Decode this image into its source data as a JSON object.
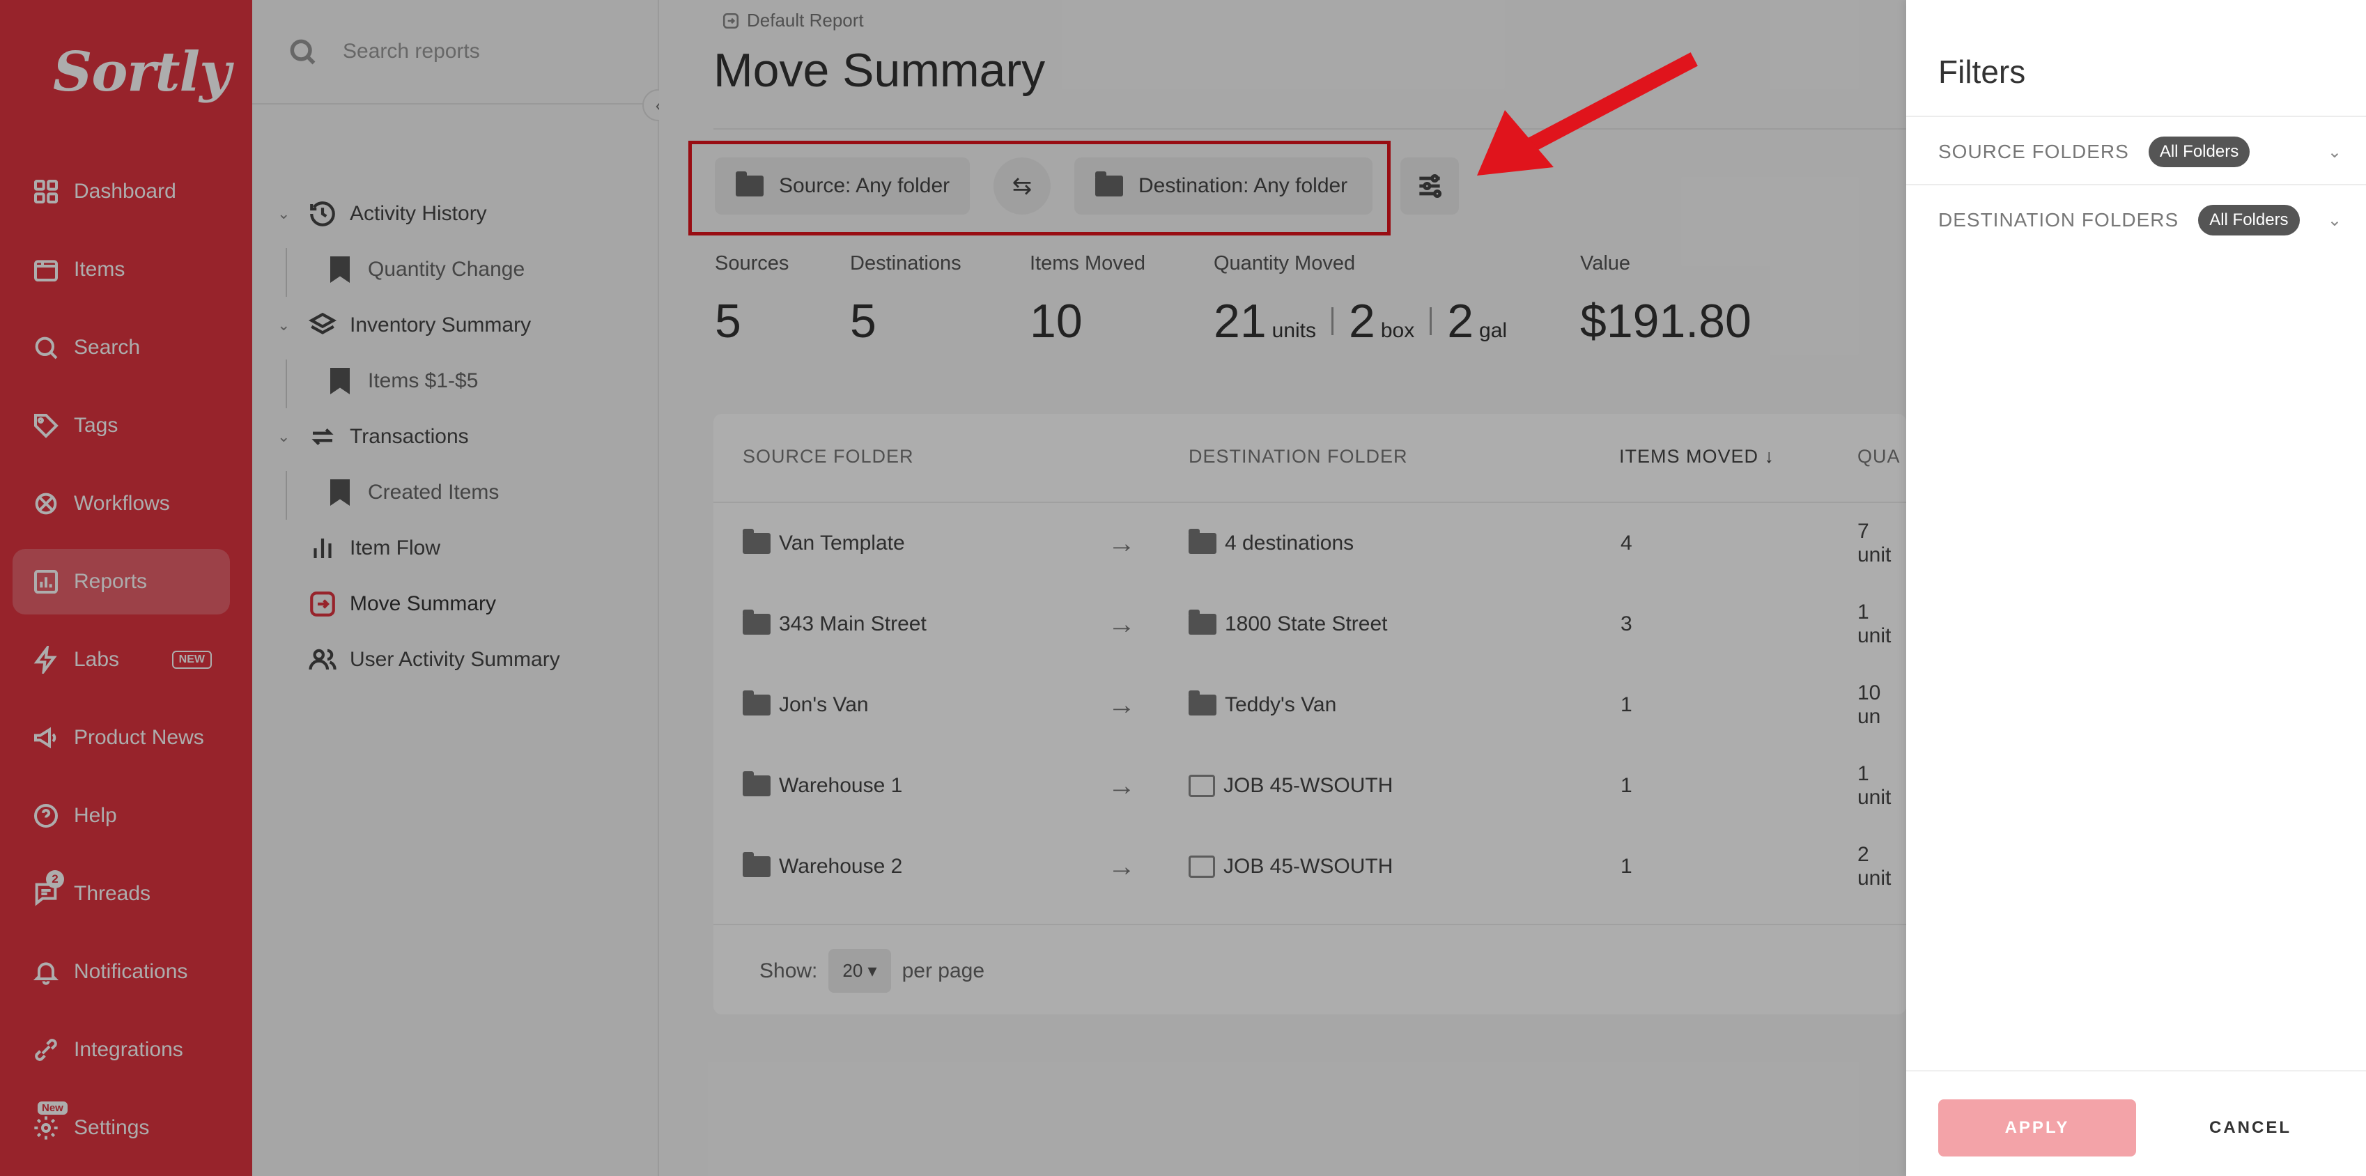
{
  "brand": {
    "logo": "Sortly",
    "color": "#df3440"
  },
  "sidebar": {
    "items": [
      {
        "label": "Dashboard",
        "icon": "dashboard-icon"
      },
      {
        "label": "Items",
        "icon": "items-icon"
      },
      {
        "label": "Search",
        "icon": "search-icon"
      },
      {
        "label": "Tags",
        "icon": "tag-icon"
      },
      {
        "label": "Workflows",
        "icon": "workflows-icon"
      },
      {
        "label": "Reports",
        "icon": "reports-icon",
        "active": true
      },
      {
        "label": "Labs",
        "icon": "lightning-icon",
        "badge": "NEW"
      },
      {
        "label": "Product News",
        "icon": "megaphone-icon"
      },
      {
        "label": "Help",
        "icon": "help-icon"
      },
      {
        "label": "Threads",
        "icon": "threads-icon",
        "count": "2"
      },
      {
        "label": "Notifications",
        "icon": "bell-icon"
      },
      {
        "label": "Integrations",
        "icon": "integrations-icon"
      },
      {
        "label": "Settings",
        "icon": "gear-icon",
        "tag": "New"
      }
    ]
  },
  "reports_panel": {
    "search_placeholder": "Search reports",
    "tree": [
      {
        "label": "Activity History",
        "icon": "history-icon"
      },
      {
        "label": "Quantity Change",
        "child": true
      },
      {
        "label": "Inventory Summary",
        "icon": "layers-icon"
      },
      {
        "label": "Items $1-$5",
        "child": true
      },
      {
        "label": "Transactions",
        "icon": "transactions-icon"
      },
      {
        "label": "Created Items",
        "child": true
      },
      {
        "label": "Item Flow",
        "icon": "bar-chart-icon"
      },
      {
        "label": "Move Summary",
        "icon": "move-icon"
      },
      {
        "label": "User Activity Summary",
        "icon": "users-icon"
      }
    ]
  },
  "main": {
    "breadcrumb": "Default Report",
    "title": "Move Summary",
    "source_filter": "Source: Any folder",
    "destination_filter": "Destination: Any folder",
    "stats": {
      "sources_label": "Sources",
      "sources": "5",
      "destinations_label": "Destinations",
      "destinations": "5",
      "items_moved_label": "Items Moved",
      "items_moved": "10",
      "quantity_label": "Quantity Moved",
      "q1": "21",
      "q1_unit": "units",
      "q2": "2",
      "q2_unit": "box",
      "q3": "2",
      "q3_unit": "gal",
      "value_label": "Value",
      "value": "$191.80"
    },
    "table": {
      "headers": {
        "source": "SOURCE FOLDER",
        "destination": "DESTINATION FOLDER",
        "items_moved": "ITEMS MOVED",
        "quantity": "QUA"
      },
      "rows": [
        {
          "source": "Van Template",
          "destination": "4 destinations",
          "items": "4",
          "qty": "7 unit"
        },
        {
          "source": "343 Main Street",
          "destination": "1800 State Street",
          "items": "3",
          "qty": "1 unit"
        },
        {
          "source": "Jon's Van",
          "destination": "Teddy's Van",
          "items": "1",
          "qty": "10 un"
        },
        {
          "source": "Warehouse 1",
          "destination": "JOB 45-WSOUTH",
          "items": "1",
          "qty": "1 unit"
        },
        {
          "source": "Warehouse 2",
          "destination": "JOB 45-WSOUTH",
          "items": "1",
          "qty": "2 unit"
        }
      ]
    },
    "pager": {
      "show": "Show:",
      "per_page_value": "20",
      "per_page": "per page"
    }
  },
  "drawer": {
    "title": "Filters",
    "source_label": "SOURCE FOLDERS",
    "source_chip": "All Folders",
    "destination_label": "DESTINATION FOLDERS",
    "destination_chip": "All Folders",
    "apply": "APPLY",
    "cancel": "CANCEL"
  }
}
